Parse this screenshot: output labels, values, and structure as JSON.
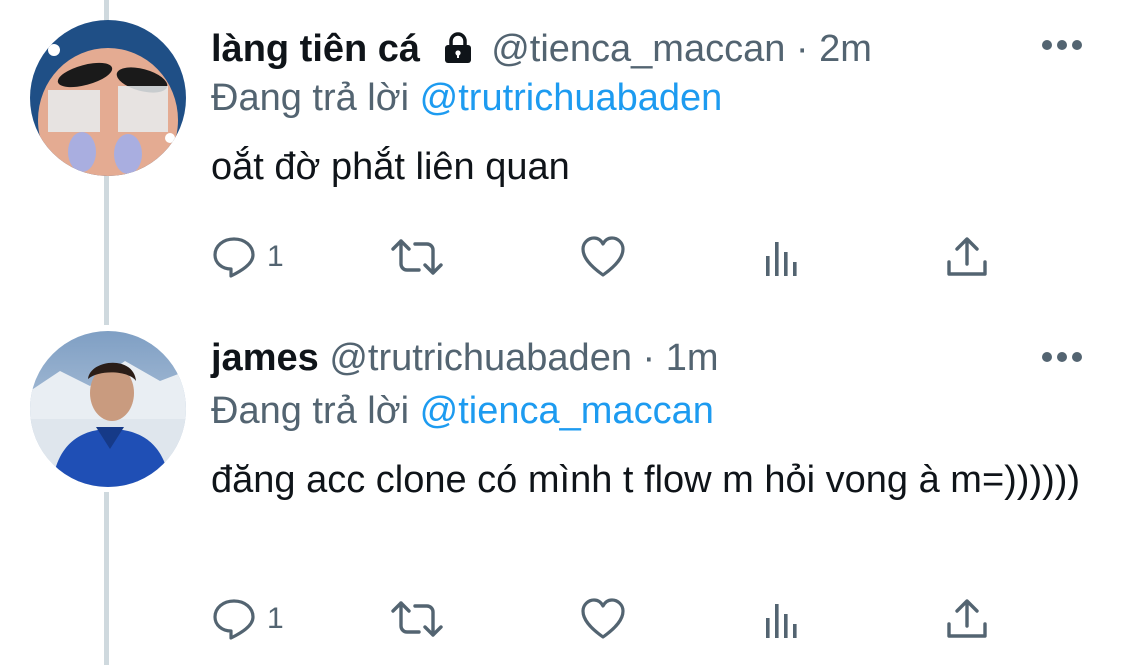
{
  "tweets": [
    {
      "display_name": "làng tiên cá",
      "handle": "@tienca_maccan",
      "separator": "·",
      "time": "2m",
      "reply_prefix": "Đang trả lời",
      "reply_to": "@trutrichuabaden",
      "text": "oắt đờ phắt liên quan",
      "reply_count": "1",
      "protected_icon": "lock-icon"
    },
    {
      "display_name": "james",
      "handle": "@trutrichuabaden",
      "separator": "·",
      "time": "1m",
      "reply_prefix": "Đang trả lời",
      "reply_to": "@tienca_maccan",
      "text": "đăng acc clone có mình t flow m hỏi vong à m=))))))",
      "reply_count": "1"
    }
  ],
  "colors": {
    "text_primary": "#0f1419",
    "text_secondary": "#536471",
    "link": "#1d9bf0",
    "thread_line": "#cfd9de"
  },
  "icons": [
    "more-icon",
    "reply-icon",
    "retweet-icon",
    "like-icon",
    "views-icon",
    "share-icon",
    "lock-icon"
  ]
}
